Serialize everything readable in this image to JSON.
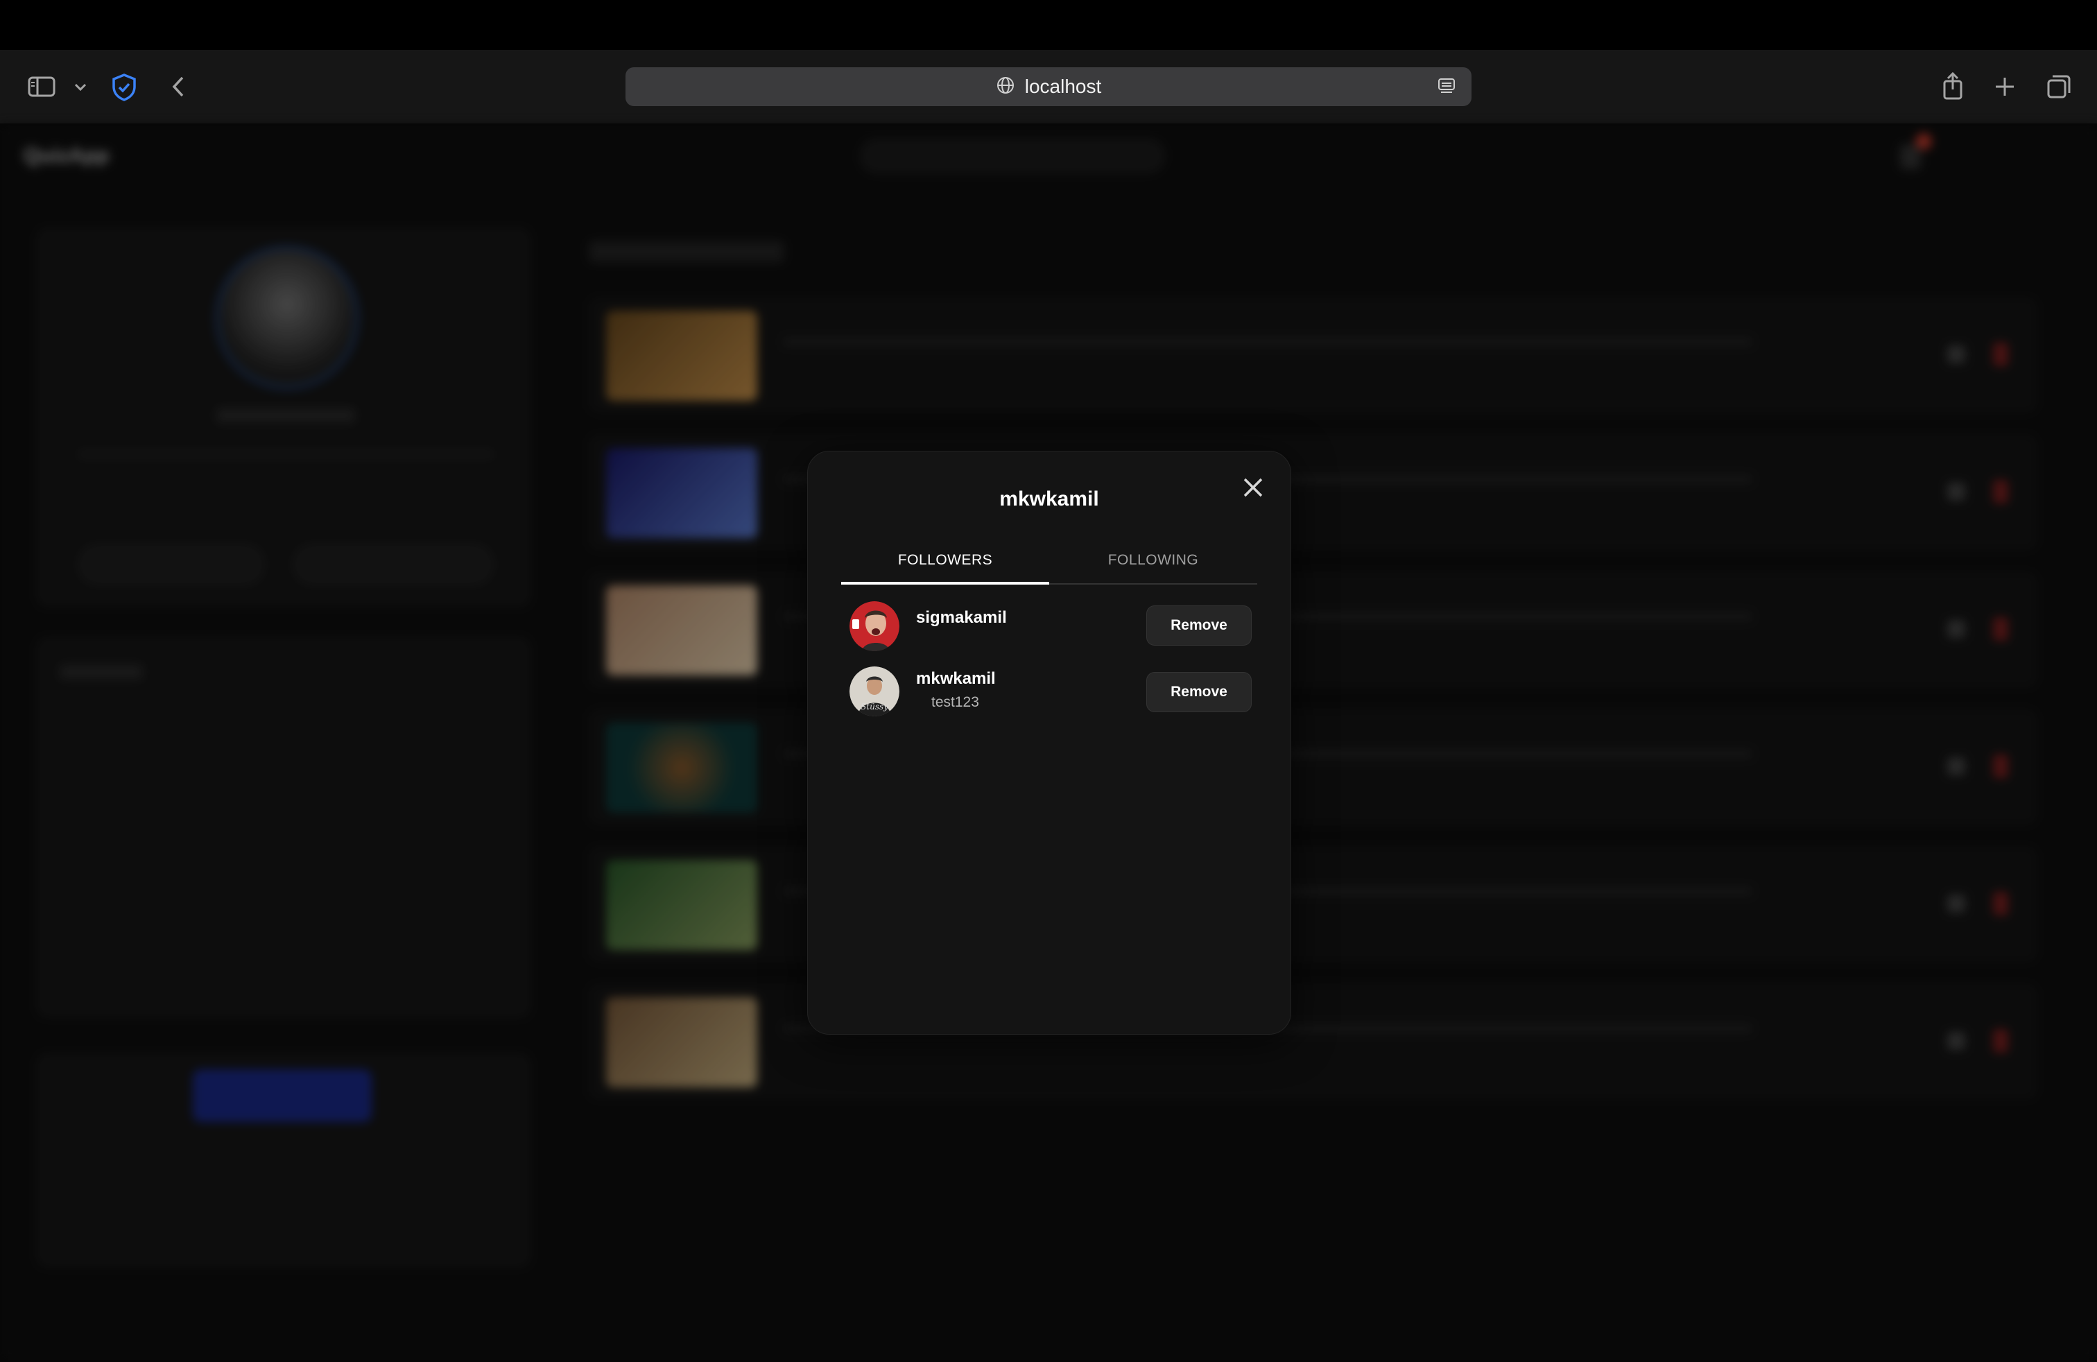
{
  "browser": {
    "url": "localhost"
  },
  "background_app": {
    "brand": "QuizApp"
  },
  "modal": {
    "title": "mkwkamil",
    "tabs": [
      {
        "label": "FOLLOWERS",
        "active": true
      },
      {
        "label": "FOLLOWING",
        "active": false
      }
    ],
    "followers": [
      {
        "username": "sigmakamil",
        "subtitle": "",
        "action_label": "Remove"
      },
      {
        "username": "mkwkamil",
        "subtitle": "test123",
        "action_label": "Remove"
      }
    ]
  }
}
